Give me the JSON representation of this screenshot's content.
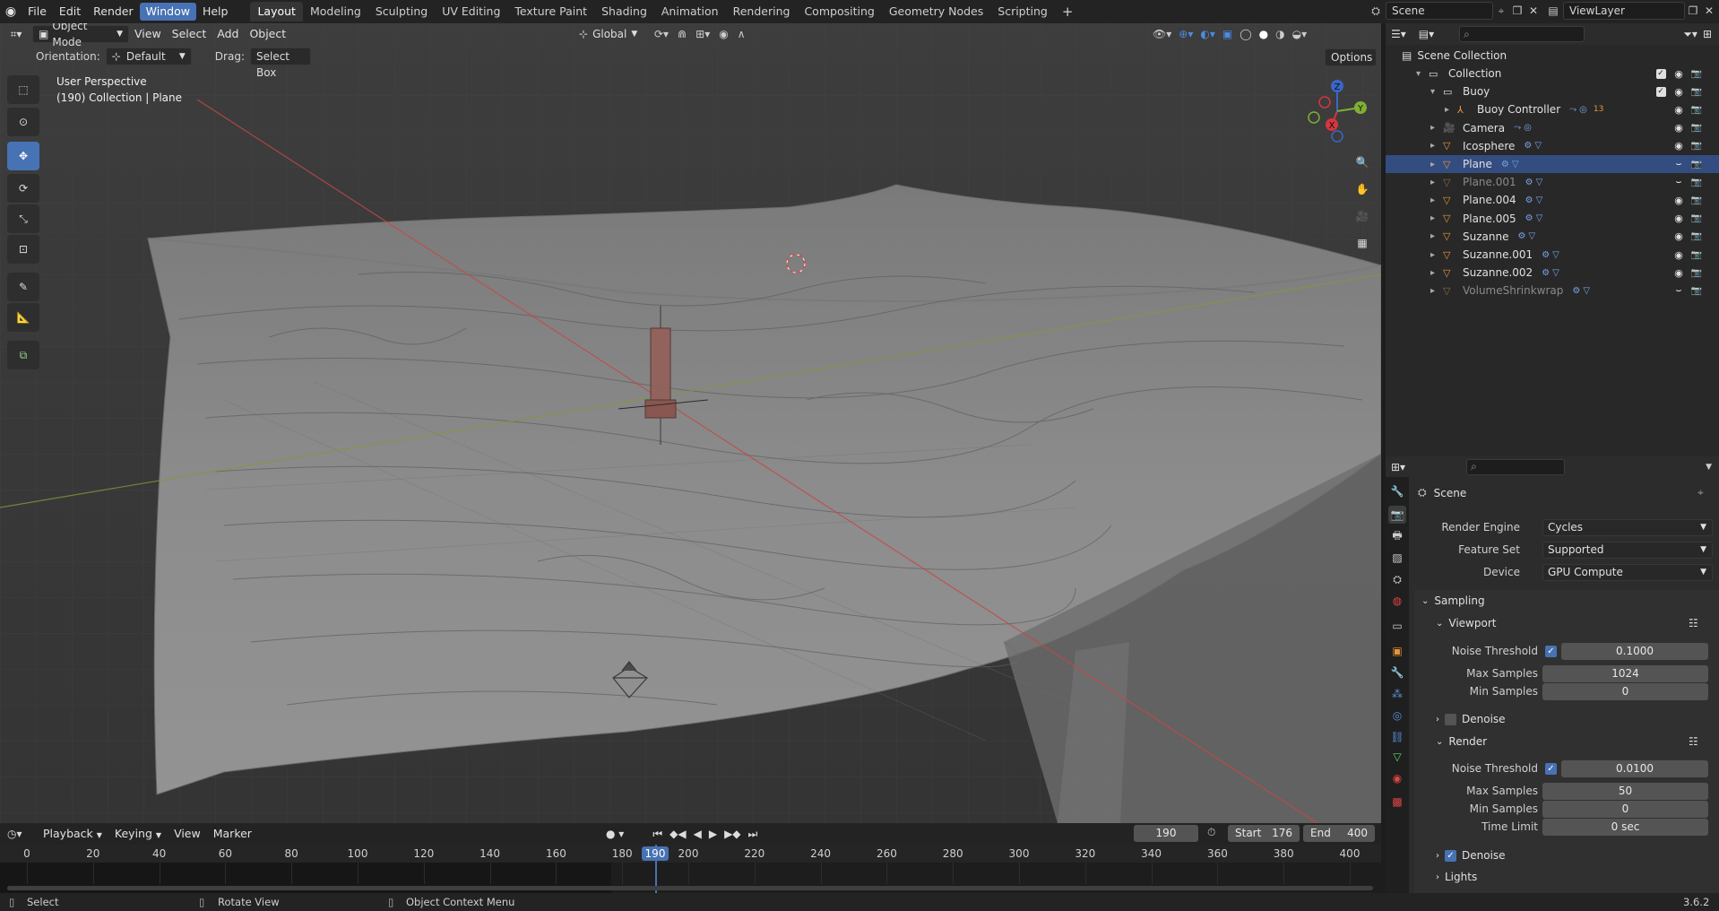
{
  "topbar": {
    "menus": [
      "File",
      "Edit",
      "Render",
      "Window",
      "Help"
    ],
    "active_menu": "Window",
    "workspaces": [
      "Layout",
      "Modeling",
      "Sculpting",
      "UV Editing",
      "Texture Paint",
      "Shading",
      "Animation",
      "Rendering",
      "Compositing",
      "Geometry Nodes",
      "Scripting"
    ],
    "active_workspace": "Layout",
    "add_tab": "+",
    "scene": "Scene",
    "view_layer": "ViewLayer"
  },
  "viewport": {
    "mode": "Object Mode",
    "menus": [
      "View",
      "Select",
      "Add",
      "Object"
    ],
    "transform_orientation": "Global",
    "orientation_label": "Orientation:",
    "orientation_value": "Default",
    "drag_label": "Drag:",
    "drag_value": "Select Box",
    "options": "Options",
    "view_name": "User Perspective",
    "view_context": "(190) Collection | Plane",
    "gizmo_axes": [
      "Z",
      "Y",
      "X"
    ]
  },
  "outliner": {
    "search_placeholder": "",
    "root": "Scene Collection",
    "rows": [
      {
        "label": "Collection",
        "indent": 1,
        "type": "collection"
      },
      {
        "label": "Buoy",
        "indent": 2,
        "type": "collection"
      },
      {
        "label": "Buoy Controller",
        "indent": 3,
        "type": "armature",
        "badge": "13"
      },
      {
        "label": "Camera",
        "indent": 2,
        "type": "camera"
      },
      {
        "label": "Icosphere",
        "indent": 2,
        "type": "mesh"
      },
      {
        "label": "Plane",
        "indent": 2,
        "type": "mesh",
        "selected": true
      },
      {
        "label": "Plane.001",
        "indent": 2,
        "type": "mesh",
        "dim": true
      },
      {
        "label": "Plane.004",
        "indent": 2,
        "type": "mesh"
      },
      {
        "label": "Plane.005",
        "indent": 2,
        "type": "mesh"
      },
      {
        "label": "Suzanne",
        "indent": 2,
        "type": "mesh"
      },
      {
        "label": "Suzanne.001",
        "indent": 2,
        "type": "mesh"
      },
      {
        "label": "Suzanne.002",
        "indent": 2,
        "type": "mesh"
      },
      {
        "label": "VolumeShrinkwrap",
        "indent": 2,
        "type": "mesh",
        "dim": true
      }
    ]
  },
  "properties": {
    "context": "Scene",
    "render_engine_label": "Render Engine",
    "render_engine": "Cycles",
    "feature_set_label": "Feature Set",
    "feature_set": "Supported",
    "device_label": "Device",
    "device": "GPU Compute",
    "sampling": "Sampling",
    "viewport": "Viewport",
    "vp_noise_label": "Noise Threshold",
    "vp_noise": "0.1000",
    "vp_max_label": "Max Samples",
    "vp_max": "1024",
    "vp_min_label": "Min Samples",
    "vp_min": "0",
    "vp_denoise": "Denoise",
    "render": "Render",
    "r_noise_label": "Noise Threshold",
    "r_noise": "0.0100",
    "r_max_label": "Max Samples",
    "r_max": "50",
    "r_min_label": "Min Samples",
    "r_min": "0",
    "r_time_label": "Time Limit",
    "r_time": "0 sec",
    "r_denoise": "Denoise",
    "lights": "Lights"
  },
  "timeline": {
    "playback": "Playback",
    "keying": "Keying",
    "view": "View",
    "marker": "Marker",
    "current_frame": "190",
    "start_label": "Start",
    "start": "176",
    "end_label": "End",
    "end": "400",
    "ticks": [
      "0",
      "20",
      "40",
      "60",
      "80",
      "100",
      "120",
      "140",
      "160",
      "180",
      "200",
      "220",
      "240",
      "260",
      "280",
      "300",
      "320",
      "340",
      "360",
      "380",
      "400"
    ],
    "playhead": "190"
  },
  "status": {
    "select": "Select",
    "rotate": "Rotate View",
    "context_menu": "Object Context Menu",
    "version": "3.6.2"
  },
  "colors": {
    "accent": "#4772b3",
    "mesh": "#e8943a",
    "selected_row": "#334d80"
  }
}
